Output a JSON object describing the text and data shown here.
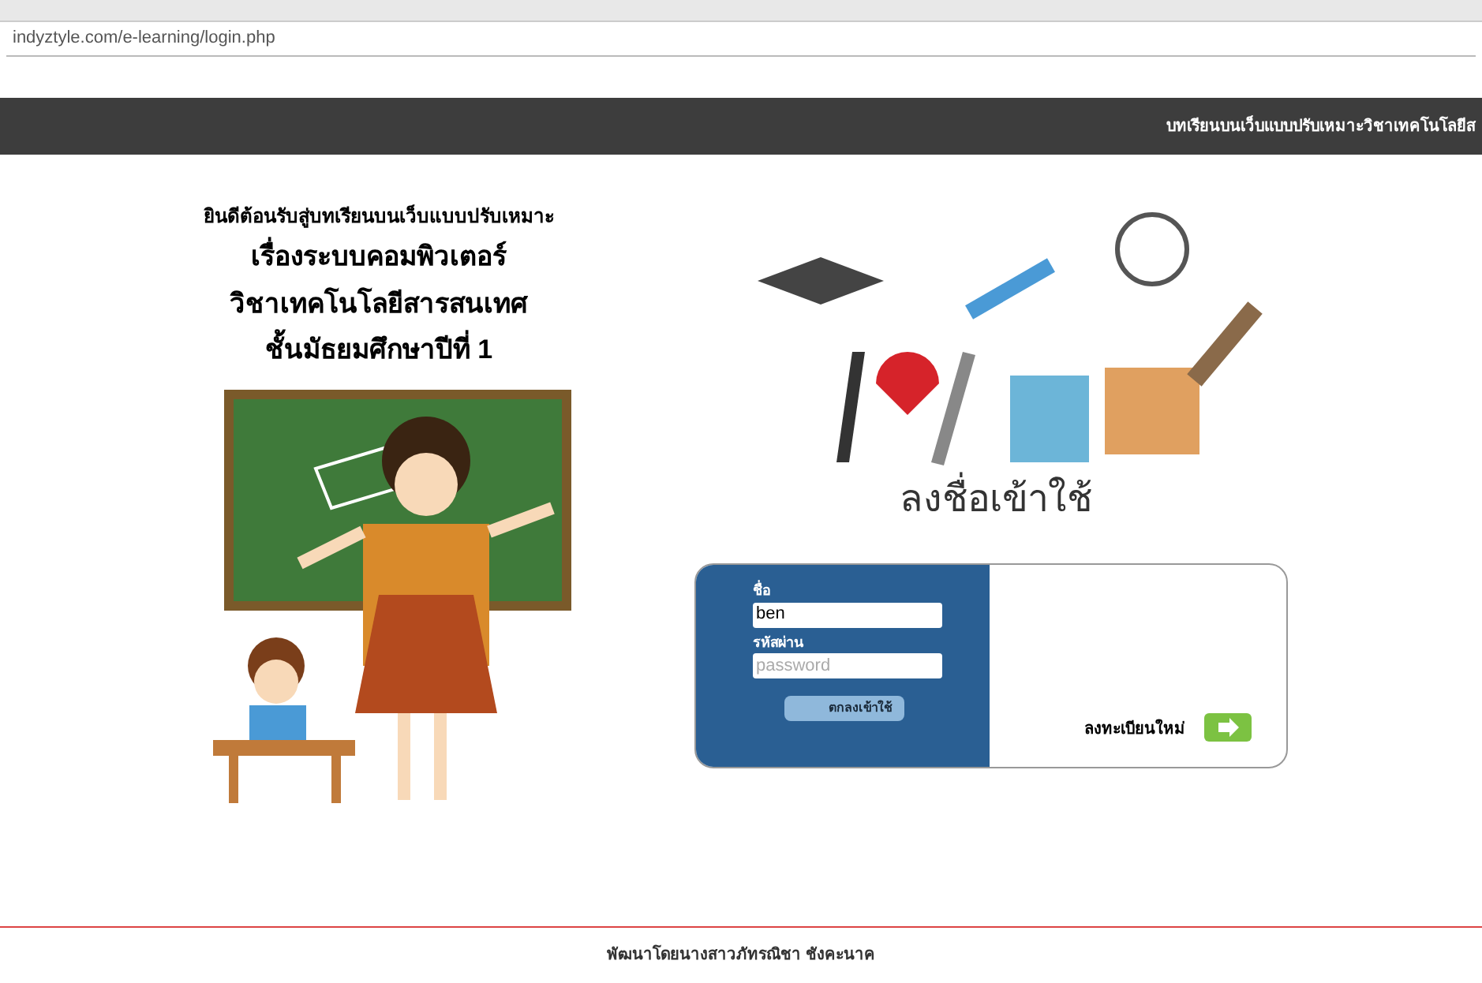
{
  "address_bar": {
    "url": "indyztyle.com/e-learning/login.php"
  },
  "header": {
    "title": "บทเรียนบนเว็บแบบปรับเหมาะวิชาเทคโนโลยีส"
  },
  "intro": [
    "ยินดีต้อนรับสู่บทเรียนบนเว็บแบบปรับเหมาะ",
    "เรื่องระบบคอมพิวเตอร์",
    "วิชาเทคโนโลยีสารสนเทศ",
    "ชั้นมัธยมศึกษาปีที่  1"
  ],
  "login": {
    "title": "ลงชื่อเข้าใช้",
    "fields": [
      {
        "label": "ชื่อ",
        "value": "ben"
      },
      {
        "label": "รหัสผ่าน",
        "placeholder": "password"
      }
    ],
    "submit": "ตกลงเข้าใช้",
    "register": "ลงทะเบียนใหม่"
  },
  "footer": "พัฒนาโดยนางสาวภัทรณิชา ชังคะนาค"
}
